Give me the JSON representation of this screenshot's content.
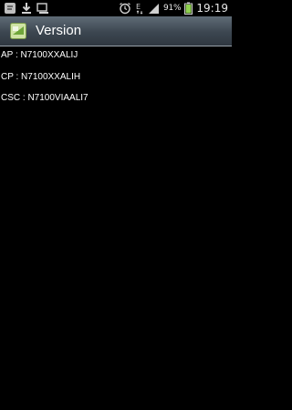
{
  "status_bar": {
    "icons_left": [
      "notification-icon",
      "download-icon",
      "usb-icon"
    ],
    "icons_right": [
      "alarm-icon",
      "edge-data-icon",
      "signal-icon",
      "battery-icon"
    ],
    "network_type": "E",
    "battery_percent": "91%",
    "time": "19:19"
  },
  "title_bar": {
    "app_icon": "android-app-icon",
    "title": "Version"
  },
  "content": {
    "lines": [
      "AP : N7100XXALIJ",
      "CP : N7100XXALIH",
      "CSC : N7100VIAALI7"
    ]
  }
}
